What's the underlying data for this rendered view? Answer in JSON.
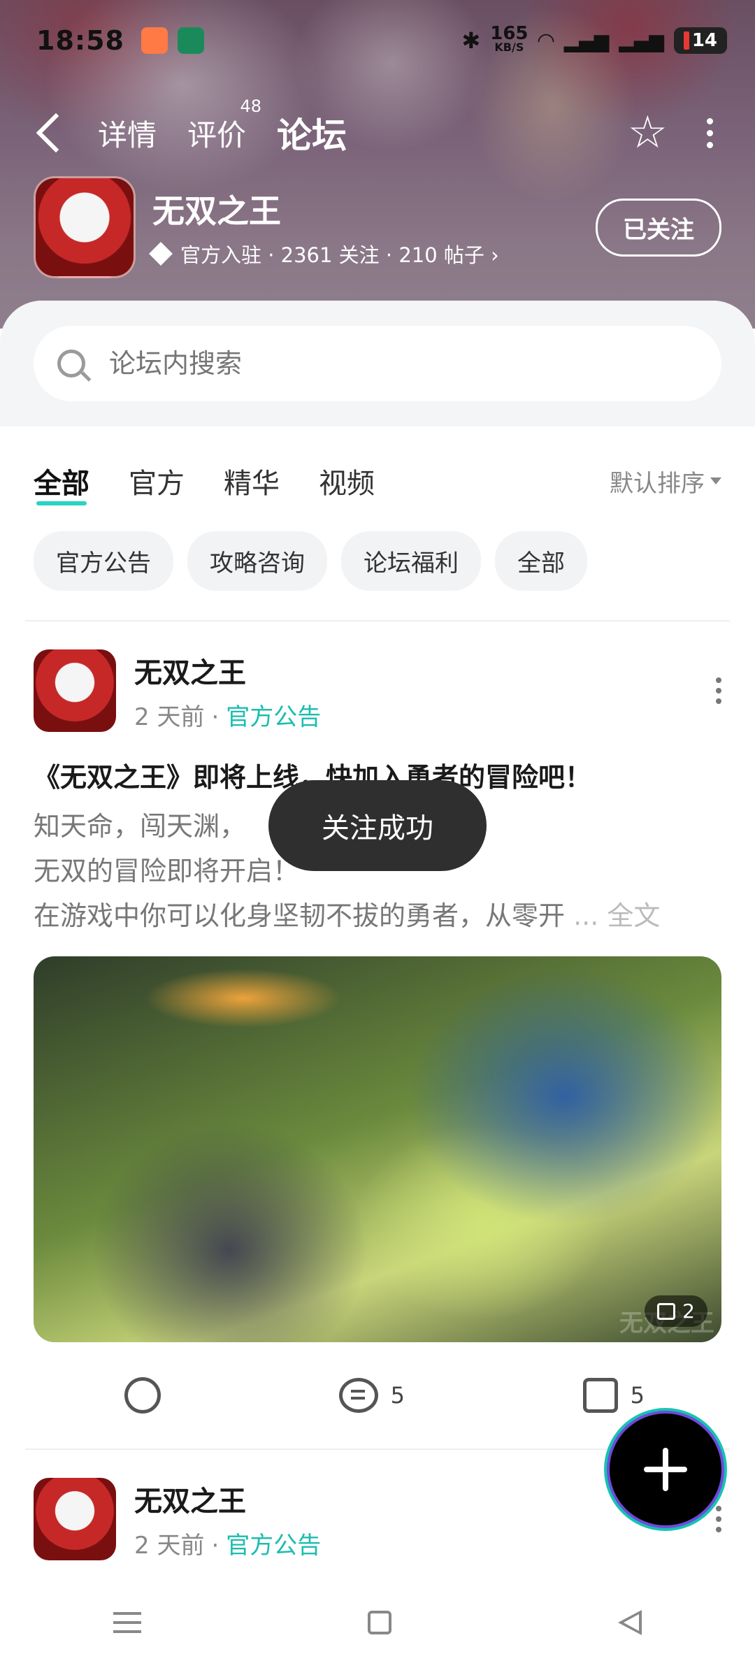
{
  "status_bar": {
    "time": "18:58",
    "network_speed_value": "165",
    "network_speed_unit": "KB/S",
    "battery": "14",
    "icons": [
      "game-app-icon",
      "xbox-app-icon",
      "bluetooth-icon",
      "wifi-icon",
      "5g-signal-icon",
      "5g-signal-icon",
      "battery-icon"
    ]
  },
  "nav": {
    "tabs": [
      {
        "label": "详情"
      },
      {
        "label": "评价",
        "count": "48"
      },
      {
        "label": "论坛"
      }
    ]
  },
  "game": {
    "title": "无双之王",
    "meta": "官方入驻 · 2361 关注 · 210 帖子 ›",
    "follow_label": "已关注"
  },
  "search": {
    "placeholder": "论坛内搜索"
  },
  "filters": {
    "tabs": [
      "全部",
      "官方",
      "精华",
      "视频"
    ],
    "sort_label": "默认排序"
  },
  "chips": [
    "官方公告",
    "攻略咨询",
    "论坛福利",
    "全部"
  ],
  "posts": [
    {
      "author": "无双之王",
      "time": "2 天前",
      "category": "官方公告",
      "title": "《无双之王》即将上线，快加入勇者的冒险吧！",
      "body_line1": "知天命，闯天渊，",
      "body_line2": "无双的冒险即将开启！",
      "body_line3": "在游戏中你可以化身坚韧不拔的勇者，从零开",
      "ellipsis": " ... ",
      "full_text_label": "全文",
      "image_count": "2",
      "watermark": "无双之王",
      "comments": "5",
      "likes": "5"
    },
    {
      "author": "无双之王",
      "time": "2 天前",
      "category": "官方公告"
    }
  ],
  "toast": {
    "message": "关注成功"
  },
  "colors": {
    "accent": "#27d3c3",
    "category": "#1cbdb0",
    "toast_bg": "#2f2f2f"
  }
}
